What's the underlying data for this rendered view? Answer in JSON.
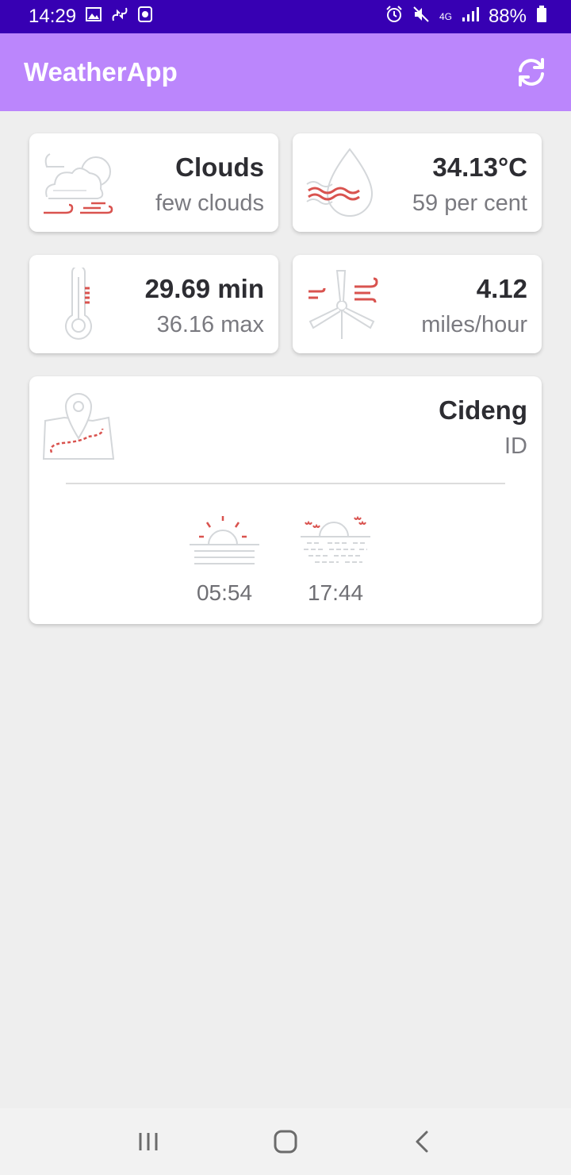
{
  "status_bar": {
    "time": "14:29",
    "battery": "88%",
    "network": "4G",
    "icons": [
      "image-icon",
      "cloud-sync-icon",
      "screen-record-icon",
      "alarm-icon",
      "mute-icon",
      "signal-icon",
      "battery-icon"
    ]
  },
  "app_bar": {
    "title": "WeatherApp",
    "refresh_icon": "refresh-icon"
  },
  "cards": {
    "condition": {
      "main": "Clouds",
      "sub": "few clouds",
      "icon": "cloud-wind-icon"
    },
    "humidity": {
      "main": "34.13°C",
      "sub": "59 per cent",
      "icon": "humidity-drop-icon"
    },
    "temperature": {
      "main": "29.69 min",
      "sub": "36.16 max",
      "icon": "thermometer-icon"
    },
    "wind": {
      "main": "4.12",
      "sub": "miles/hour",
      "icon": "wind-turbine-icon"
    }
  },
  "location": {
    "city": "Cideng",
    "country": "ID",
    "icon": "map-pin-icon",
    "sunrise": {
      "time": "05:54",
      "icon": "sunrise-icon"
    },
    "sunset": {
      "time": "17:44",
      "icon": "sunset-icon"
    }
  },
  "nav_bar": {
    "icons": [
      "recent-apps-icon",
      "home-icon",
      "back-icon"
    ]
  },
  "colors": {
    "status_bar": "#3700b3",
    "app_bar": "#bb86fc",
    "background": "#eeeeee",
    "icon_accent": "#d9534f",
    "icon_line": "#c9cdd1"
  }
}
